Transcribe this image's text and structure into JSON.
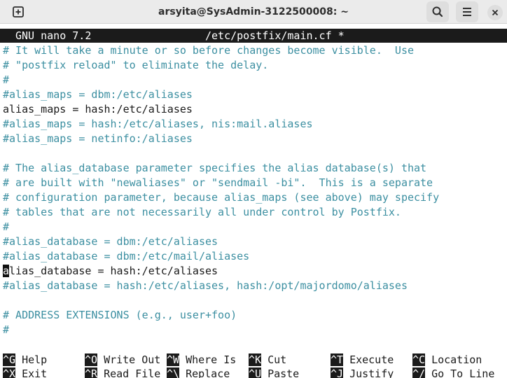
{
  "window": {
    "title": "arsyita@SysAdmin-3122500008: ~"
  },
  "nano": {
    "version": "GNU nano 7.2",
    "file": "/etc/postfix/main.cf *"
  },
  "lines": [
    "# It will take a minute or so before changes become visible.  Use",
    "# \"postfix reload\" to eliminate the delay.",
    "#",
    "#alias_maps = dbm:/etc/aliases",
    "alias_maps = hash:/etc/aliases",
    "#alias_maps = hash:/etc/aliases, nis:mail.aliases",
    "#alias_maps = netinfo:/aliases",
    "",
    "# The alias_database parameter specifies the alias database(s) that",
    "# are built with \"newaliases\" or \"sendmail -bi\".  This is a separate",
    "# configuration parameter, because alias_maps (see above) may specify",
    "# tables that are not necessarily all under control by Postfix.",
    "#",
    "#alias_database = dbm:/etc/aliases",
    "#alias_database = dbm:/etc/mail/aliases",
    "alias_database = hash:/etc/aliases",
    "#alias_database = hash:/etc/aliases, hash:/opt/majordomo/aliases",
    "",
    "# ADDRESS EXTENSIONS (e.g., user+foo)",
    "#"
  ],
  "cursor_line": {
    "char": "a",
    "rest": "lias_database = hash:/etc/aliases"
  },
  "shortcuts": [
    {
      "key": "^G",
      "label": "Help"
    },
    {
      "key": "^O",
      "label": "Write Out"
    },
    {
      "key": "^W",
      "label": "Where Is"
    },
    {
      "key": "^K",
      "label": "Cut"
    },
    {
      "key": "^T",
      "label": "Execute"
    },
    {
      "key": "^C",
      "label": "Location"
    },
    {
      "key": "^X",
      "label": "Exit"
    },
    {
      "key": "^R",
      "label": "Read File"
    },
    {
      "key": "^\\",
      "label": "Replace"
    },
    {
      "key": "^U",
      "label": "Paste"
    },
    {
      "key": "^J",
      "label": "Justify"
    },
    {
      "key": "^/",
      "label": "Go To Line"
    }
  ],
  "icons": {
    "new_tab": "new-tab-icon",
    "search": "search-icon",
    "menu": "hamburger-menu-icon",
    "close": "close-icon"
  },
  "colors": {
    "comment": "#3c8fa1",
    "text": "#1a1a1a",
    "header_bg": "#1b1b1b"
  }
}
